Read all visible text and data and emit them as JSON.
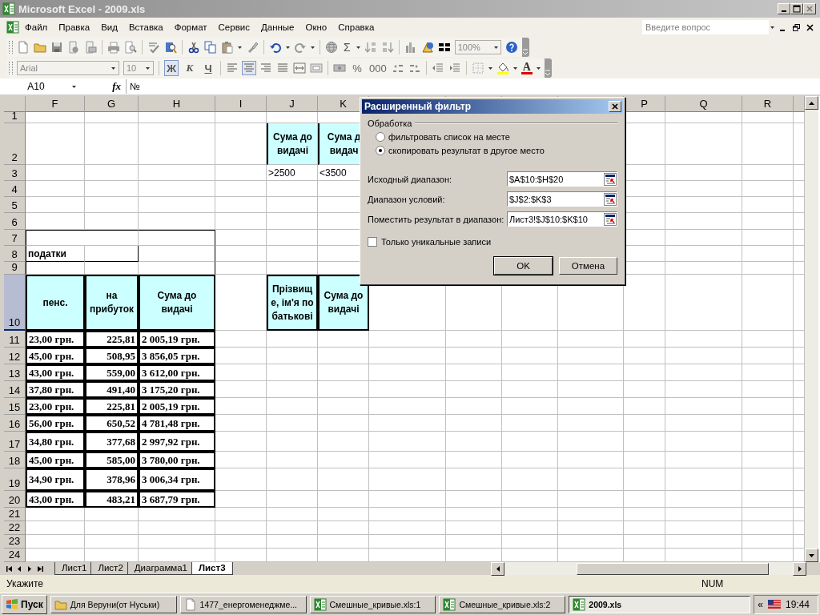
{
  "window": {
    "title": "Microsoft Excel - 2009.xls"
  },
  "menu": [
    "Файл",
    "Правка",
    "Вид",
    "Вставка",
    "Формат",
    "Сервис",
    "Данные",
    "Окно",
    "Справка"
  ],
  "help_search": {
    "placeholder": "Введите вопрос"
  },
  "standard_toolbar": {
    "autosum": "Σ",
    "zoom": "100%"
  },
  "formatting_toolbar": {
    "font": "Arial",
    "size": "10",
    "buttons": [
      {
        "label": "Ж",
        "pressed": true
      },
      {
        "label": "К",
        "pressed": false
      },
      {
        "label": "Ч",
        "pressed": false
      }
    ],
    "alignment": [
      {
        "pressed": false
      },
      {
        "pressed": true
      },
      {
        "pressed": false
      },
      {
        "pressed": false
      }
    ],
    "percent": "%",
    "thousands": "000",
    "font_color": "A"
  },
  "formula_bar": {
    "name_box": "A10",
    "function_label": "fx",
    "formula": "№"
  },
  "sheet": {
    "columns": [
      "F",
      "G",
      "H",
      "I",
      "J",
      "K"
    ],
    "columns_right": [
      "P",
      "Q",
      "R"
    ],
    "rows": [
      {
        "number": "1",
        "kind": "blank",
        "selected": false,
        "cells": []
      },
      {
        "number": "2",
        "kind": "criteria_header",
        "selected": false,
        "cells": [
          null,
          null,
          null,
          null,
          "Сума до видачі",
          "Сума д видач"
        ]
      },
      {
        "number": "3",
        "kind": "criteria",
        "selected": false,
        "cells": [
          null,
          null,
          null,
          null,
          ">2500",
          "<3500"
        ]
      },
      {
        "number": "4",
        "kind": "blank",
        "selected": false,
        "cells": []
      },
      {
        "number": "5",
        "kind": "blank",
        "selected": false,
        "cells": []
      },
      {
        "number": "6",
        "kind": "blank",
        "selected": false,
        "cells": []
      },
      {
        "number": "7",
        "kind": "box_top",
        "selected": false,
        "cells": []
      },
      {
        "number": "8",
        "kind": "label",
        "selected": false,
        "cells": [
          "податки"
        ]
      },
      {
        "number": "9",
        "kind": "box_bottom",
        "selected": false,
        "cells": []
      },
      {
        "number": "10",
        "kind": "table_header",
        "selected": true,
        "cells": [
          "пенс.",
          "на прибуток",
          "Сума до видачі",
          null,
          "Прізвище, ім'я по батькові",
          "Сума до видачі"
        ]
      },
      {
        "number": "11",
        "kind": "data",
        "selected": false,
        "cells": [
          "23,00 грн.",
          "225,81",
          "2 005,19 грн."
        ]
      },
      {
        "number": "12",
        "kind": "data",
        "selected": false,
        "cells": [
          "45,00 грн.",
          "508,95",
          "3 856,05 грн."
        ]
      },
      {
        "number": "13",
        "kind": "data",
        "selected": false,
        "cells": [
          "43,00 грн.",
          "559,00",
          "3 612,00 грн."
        ]
      },
      {
        "number": "14",
        "kind": "data",
        "selected": false,
        "cells": [
          "37,80 грн.",
          "491,40",
          "3 175,20 грн."
        ]
      },
      {
        "number": "15",
        "kind": "data",
        "selected": false,
        "cells": [
          "23,00 грн.",
          "225,81",
          "2 005,19 грн."
        ]
      },
      {
        "number": "16",
        "kind": "data",
        "selected": false,
        "cells": [
          "56,00 грн.",
          "650,52",
          "4 781,48 грн."
        ]
      },
      {
        "number": "17",
        "kind": "data",
        "selected": false,
        "cells": [
          "34,80 грн.",
          "377,68",
          "2 997,92 грн."
        ]
      },
      {
        "number": "18",
        "kind": "data",
        "selected": false,
        "cells": [
          "45,00 грн.",
          "585,00",
          "3 780,00 грн."
        ]
      },
      {
        "number": "19",
        "kind": "data",
        "selected": false,
        "cells": [
          "34,90 грн.",
          "378,96",
          "3 006,34 грн."
        ]
      },
      {
        "number": "20",
        "kind": "data",
        "selected": false,
        "cells": [
          "43,00 грн.",
          "483,21",
          "3 687,79 грн."
        ]
      },
      {
        "number": "21",
        "kind": "blank",
        "selected": false,
        "cells": []
      },
      {
        "number": "22",
        "kind": "blank",
        "selected": false,
        "cells": []
      },
      {
        "number": "23",
        "kind": "blank",
        "selected": false,
        "cells": []
      },
      {
        "number": "24",
        "kind": "blank",
        "selected": false,
        "cells": []
      }
    ]
  },
  "sheet_tabs": [
    {
      "label": "Лист1",
      "selected": false
    },
    {
      "label": "Лист2",
      "selected": false
    },
    {
      "label": "Диаграмма1",
      "selected": false
    },
    {
      "label": "Лист3",
      "selected": true
    }
  ],
  "status_bar": {
    "mode": "Укажите",
    "indicator": "NUM"
  },
  "dialog": {
    "title": "Расширенный фильтр",
    "group": "Обработка",
    "options": [
      {
        "label": "фильтровать список на месте",
        "selected": false
      },
      {
        "label": "скопировать результат в другое место",
        "selected": true
      }
    ],
    "fields": [
      {
        "label": "Исходный диапазон:",
        "value": "$A$10:$H$20"
      },
      {
        "label": "Диапазон условий:",
        "value": "$J$2:$K$3"
      },
      {
        "label": "Поместить результат в диапазон:",
        "value": "Лист3!$J$10:$K$10"
      }
    ],
    "unique_only": {
      "label": "Только уникальные записи",
      "checked": false
    },
    "buttons": [
      "OK",
      "Отмена"
    ]
  },
  "taskbar": {
    "start": "Пуск",
    "items": [
      {
        "label": "Для Веруни(от Нуськи)",
        "kind": "folder",
        "selected": false
      },
      {
        "label": "1477_енергоменеджме...",
        "kind": "document",
        "selected": false
      },
      {
        "label": "Смешные_кривые.xls:1",
        "kind": "spreadsheet",
        "selected": false
      },
      {
        "label": "Смешные_кривые.xls:2",
        "kind": "spreadsheet",
        "selected": false
      },
      {
        "label": "2009.xls",
        "kind": "spreadsheet",
        "selected": true
      }
    ],
    "tray_expand": "«",
    "clock": "19:44"
  }
}
